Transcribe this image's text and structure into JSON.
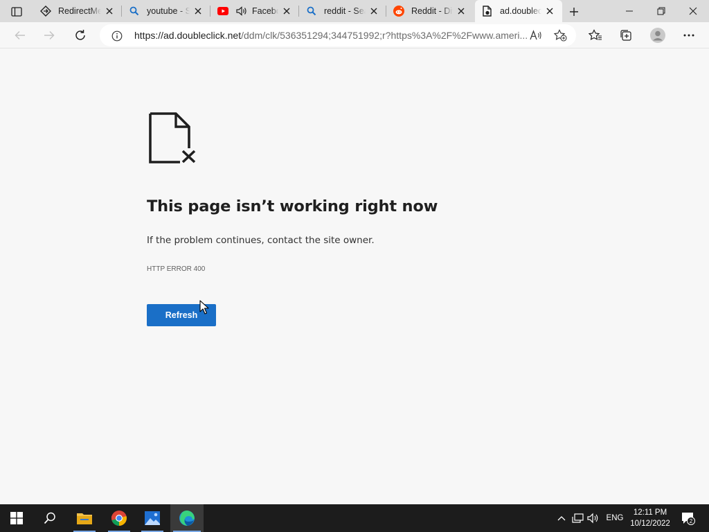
{
  "browser": {
    "tabs": [
      {
        "title": "RedirectMe",
        "favicon": "redirect-icon"
      },
      {
        "title": "youtube - Search",
        "favicon": "search-icon"
      },
      {
        "title": "Facebook",
        "favicon": "youtube-icon",
        "muted_audio": "speaker-icon"
      },
      {
        "title": "reddit - Search",
        "favicon": "search-icon"
      },
      {
        "title": "Reddit - Dive into anything",
        "favicon": "reddit-icon"
      },
      {
        "title": "ad.doubleclick.net",
        "favicon": "page-error-icon",
        "active": true
      }
    ],
    "address": {
      "host_part": "https://ad.doubleclick.net",
      "path_part": "/ddm/clk/536351294;344751992;r?https%3A%2F%2Fwww.ameri..."
    }
  },
  "page": {
    "title": "This page isn’t working right now",
    "message": "If the problem continues, contact the site owner.",
    "error_code": "HTTP ERROR 400",
    "refresh_label": "Refresh"
  },
  "taskbar": {
    "language": "ENG",
    "time": "12:11 PM",
    "date": "10/12/2022",
    "notification_count": "2"
  },
  "colors": {
    "accent": "#1a6fc7",
    "taskbar": "#1c1c1c",
    "youtube": "#ff0000",
    "reddit": "#ff4500"
  }
}
